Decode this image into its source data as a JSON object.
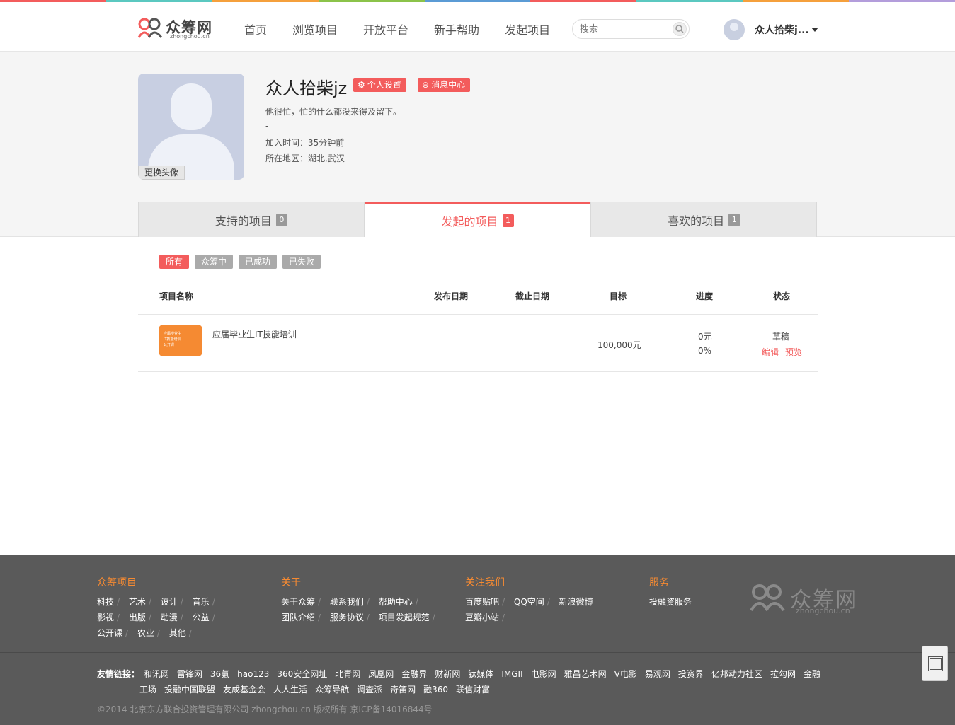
{
  "stripe_colors": [
    "#f35c5c",
    "#5bc8c0",
    "#f5a03c",
    "#8bc34a",
    "#5b9bd5",
    "#f35c5c",
    "#5bc8c0",
    "#f5a03c",
    "#b39ddb"
  ],
  "header": {
    "logo_text": "众筹网",
    "logo_sub": "zhongchou.cn",
    "nav": [
      "首页",
      "浏览项目",
      "开放平台",
      "新手帮助",
      "发起项目"
    ],
    "search_placeholder": "搜索",
    "user_name": "众人拾柴j..."
  },
  "profile": {
    "change_avatar": "更换头像",
    "name": "众人拾柴jz",
    "settings_btn": "个人设置",
    "message_btn": "消息中心",
    "bio": "他很忙，忙的什么都没来得及留下。",
    "dash": "-",
    "joined": "加入时间：35分钟前",
    "location": "所在地区：湖北,武汉"
  },
  "tabs": [
    {
      "label": "支持的项目",
      "count": "0"
    },
    {
      "label": "发起的项目",
      "count": "1"
    },
    {
      "label": "喜欢的项目",
      "count": "1"
    }
  ],
  "filters": [
    "所有",
    "众筹中",
    "已成功",
    "已失败"
  ],
  "table": {
    "headers": [
      "项目名称",
      "发布日期",
      "截止日期",
      "目标",
      "进度",
      "状态"
    ],
    "rows": [
      {
        "thumb_lines": [
          "应届毕业生",
          "IT技能培训",
          "公开课"
        ],
        "name": "应届毕业生IT技能培训",
        "publish": "-",
        "deadline": "-",
        "goal": "100,000元",
        "raised": "0元",
        "percent": "0%",
        "status": "草稿",
        "edit": "编辑",
        "preview": "预览"
      }
    ]
  },
  "footer": {
    "cols": [
      {
        "title": "众筹项目",
        "rows": [
          [
            "科技",
            "艺术",
            "设计",
            "音乐"
          ],
          [
            "影视",
            "出版",
            "动漫",
            "公益"
          ],
          [
            "公开课",
            "农业",
            "其他"
          ]
        ]
      },
      {
        "title": "关于",
        "rows": [
          [
            "关于众筹",
            "联系我们",
            "帮助中心"
          ],
          [
            "团队介绍",
            "服务协议",
            "项目发起规范"
          ]
        ]
      },
      {
        "title": "关注我们",
        "rows": [
          [
            "百度贴吧",
            "QQ空间",
            "新浪微博"
          ],
          [
            "豆瓣小站"
          ]
        ]
      },
      {
        "title": "服务",
        "rows": [
          [
            "投融资服务"
          ]
        ]
      }
    ],
    "logo_text": "众筹网",
    "logo_sub": "zhongchou.cn",
    "friends_label": "友情链接：",
    "friends_row1": [
      "和讯网",
      "雷锋网",
      "36氪",
      "hao123",
      "360安全网址",
      "北青网",
      "凤凰网",
      "金融界",
      "财新网",
      "钛媒体",
      "IMGII",
      "电影网",
      "雅昌艺术网",
      "V电影",
      "易观网",
      "投资界",
      "亿邦动力社区",
      "拉勾网",
      "金融"
    ],
    "friends_row2": [
      "工场",
      "投融中国联盟",
      "友成基金会",
      "人人生活",
      "众筹导航",
      "调查派",
      "奇笛网",
      "融360",
      "联信财富"
    ],
    "copyright": "©2014 北京东方联合投资管理有限公司 zhongchou.cn 版权所有 京ICP备14016844号"
  }
}
